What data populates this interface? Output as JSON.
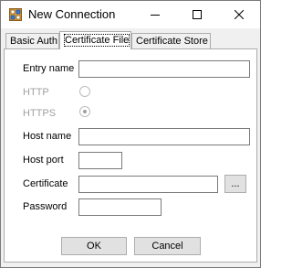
{
  "window": {
    "title": "New Connection"
  },
  "tabs": [
    {
      "label": "Basic Auth"
    },
    {
      "label": "Certificate File",
      "selected": true
    },
    {
      "label": "Certificate Store"
    }
  ],
  "form": {
    "entry_name": {
      "label": "Entry name",
      "value": ""
    },
    "http": {
      "label": "HTTP",
      "checked": false,
      "enabled": false
    },
    "https": {
      "label": "HTTPS",
      "checked": true,
      "enabled": false
    },
    "host_name": {
      "label": "Host name",
      "value": ""
    },
    "host_port": {
      "label": "Host port",
      "value": ""
    },
    "certificate": {
      "label": "Certificate",
      "value": "",
      "browse_label": "..."
    },
    "password": {
      "label": "Password",
      "value": ""
    }
  },
  "buttons": {
    "ok": "OK",
    "cancel": "Cancel"
  }
}
